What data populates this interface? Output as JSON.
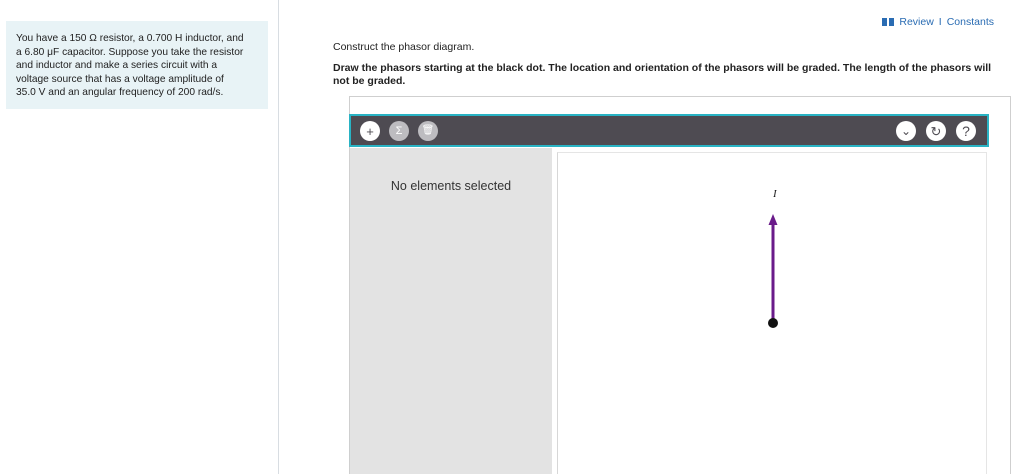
{
  "problem": {
    "lines": [
      "You have a 150 Ω resistor, a 0.700 H inductor, and",
      "a 6.80 μF capacitor. Suppose you take the resistor",
      "and inductor and make a series circuit with a",
      "voltage source that has a voltage amplitude of",
      "35.0 V and an angular frequency of 200 rad/s."
    ]
  },
  "header": {
    "review": "Review",
    "sep": "I",
    "constants": "Constants"
  },
  "part": {
    "construct": "Construct the phasor diagram.",
    "instructions": "Draw the phasors starting at the black dot. The location and orientation of the phasors will be graded. The length of the phasors will not be graded."
  },
  "toolbar": {
    "add_glyph": "+",
    "sum_glyph": "Σ",
    "delete_glyph": "🗑",
    "dropdown_glyph": "⌄",
    "reset_glyph": "↻",
    "help_glyph": "?"
  },
  "side_panel": {
    "message": "No elements selected"
  },
  "canvas": {
    "phasor": {
      "label": "I",
      "direction_deg": 90,
      "color": "#6a1b8a"
    },
    "origin_dot_color": "#111111"
  },
  "colors": {
    "accent": "#29b3c4",
    "toolbar_bg": "#4e4b52",
    "link": "#2a6cb3",
    "problem_bg": "#e8f3f6"
  }
}
